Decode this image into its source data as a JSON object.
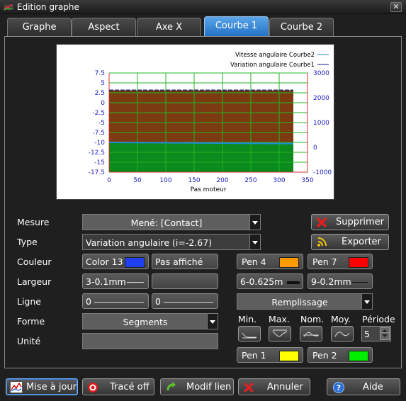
{
  "window": {
    "title": "Edition graphe",
    "close_glyph": "✕"
  },
  "tabs": [
    {
      "label": "Graphe"
    },
    {
      "label": "Aspect"
    },
    {
      "label": "Axe X"
    },
    {
      "label": "Courbe 1",
      "active": true
    },
    {
      "label": "Courbe 2"
    }
  ],
  "chart_data": {
    "type": "area",
    "xlabel": "Pas moteur",
    "x_ticks": [
      "0",
      "50",
      "100",
      "150",
      "200",
      "250",
      "300",
      "350"
    ],
    "xlim": [
      0,
      350
    ],
    "y_left_ticks": [
      "7.5",
      "5",
      "2.5",
      "0",
      "-2.5",
      "-5",
      "-7.5",
      "-10",
      "-12.5",
      "-15",
      "-17.5"
    ],
    "ylim_left": [
      -17.5,
      7.5
    ],
    "y_right_ticks": [
      "3000",
      "2000",
      "1000",
      "0",
      "-1000"
    ],
    "ylim_right": [
      -1000,
      3000
    ],
    "grid": true,
    "legend": "top-right",
    "series": [
      {
        "name": "Vitesse angulaire Courbe2",
        "axis": "right",
        "color": "#1e8fd8",
        "x": [
          0,
          325
        ],
        "values": [
          2300,
          2300
        ]
      },
      {
        "name": "Variation angulaire Courbe1",
        "axis": "left",
        "color": "#0b8a1e",
        "x": [
          0,
          325
        ],
        "values": [
          -10.0,
          -10.3
        ]
      }
    ],
    "fill_colors": {
      "upper": "#7b3a10",
      "lower": "#0b8a1e"
    }
  },
  "form": {
    "mesure_label": "Mesure",
    "mesure_value": "Mené: [Contact]",
    "type_label": "Type",
    "type_value": "Variation angulaire (i=-2.67)",
    "couleur_label": "Couleur",
    "couleur_value": "Color 13",
    "couleur_color": "#1f3ff0",
    "pas_affiche": "Pas affiché",
    "largeur_label": "Largeur",
    "largeur_value": "3-0.1mm",
    "ligne_label": "Ligne",
    "ligne_value_1": "0",
    "ligne_value_2": "0",
    "forme_label": "Forme",
    "forme_value": "Segments",
    "unite_label": "Unité",
    "unite_value": ""
  },
  "right": {
    "supprimer": "Supprimer",
    "exporter": "Exporter",
    "pen4": "Pen 4",
    "pen4_color": "#ff9a00",
    "pen7": "Pen 7",
    "pen7_color": "#ff0000",
    "width1": "6-0.625m",
    "width2": "9-0.2mm",
    "remplissage": "Remplissage",
    "min": "Min.",
    "max": "Max.",
    "nom": "Nom.",
    "moy": "Moy.",
    "periode_label": "Période",
    "periode_value": "5",
    "pen1": "Pen 1",
    "pen1_color": "#ffff00",
    "pen2": "Pen 2",
    "pen2_color": "#00ee00"
  },
  "bottom": {
    "mise_a_jour": "Mise à jour",
    "trace_off": "Tracé off",
    "modif_lien": "Modif lien",
    "annuler": "Annuler",
    "aide": "Aide"
  }
}
